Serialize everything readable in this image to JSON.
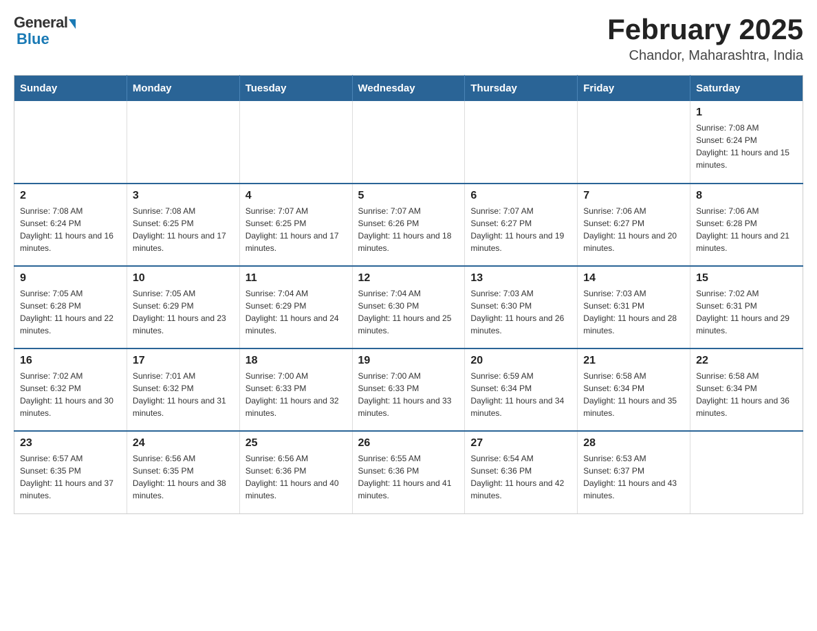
{
  "logo": {
    "general": "General",
    "blue": "Blue"
  },
  "title": "February 2025",
  "subtitle": "Chandor, Maharashtra, India",
  "weekdays": [
    "Sunday",
    "Monday",
    "Tuesday",
    "Wednesday",
    "Thursday",
    "Friday",
    "Saturday"
  ],
  "weeks": [
    [
      {
        "day": "",
        "info": ""
      },
      {
        "day": "",
        "info": ""
      },
      {
        "day": "",
        "info": ""
      },
      {
        "day": "",
        "info": ""
      },
      {
        "day": "",
        "info": ""
      },
      {
        "day": "",
        "info": ""
      },
      {
        "day": "1",
        "info": "Sunrise: 7:08 AM\nSunset: 6:24 PM\nDaylight: 11 hours and 15 minutes."
      }
    ],
    [
      {
        "day": "2",
        "info": "Sunrise: 7:08 AM\nSunset: 6:24 PM\nDaylight: 11 hours and 16 minutes."
      },
      {
        "day": "3",
        "info": "Sunrise: 7:08 AM\nSunset: 6:25 PM\nDaylight: 11 hours and 17 minutes."
      },
      {
        "day": "4",
        "info": "Sunrise: 7:07 AM\nSunset: 6:25 PM\nDaylight: 11 hours and 17 minutes."
      },
      {
        "day": "5",
        "info": "Sunrise: 7:07 AM\nSunset: 6:26 PM\nDaylight: 11 hours and 18 minutes."
      },
      {
        "day": "6",
        "info": "Sunrise: 7:07 AM\nSunset: 6:27 PM\nDaylight: 11 hours and 19 minutes."
      },
      {
        "day": "7",
        "info": "Sunrise: 7:06 AM\nSunset: 6:27 PM\nDaylight: 11 hours and 20 minutes."
      },
      {
        "day": "8",
        "info": "Sunrise: 7:06 AM\nSunset: 6:28 PM\nDaylight: 11 hours and 21 minutes."
      }
    ],
    [
      {
        "day": "9",
        "info": "Sunrise: 7:05 AM\nSunset: 6:28 PM\nDaylight: 11 hours and 22 minutes."
      },
      {
        "day": "10",
        "info": "Sunrise: 7:05 AM\nSunset: 6:29 PM\nDaylight: 11 hours and 23 minutes."
      },
      {
        "day": "11",
        "info": "Sunrise: 7:04 AM\nSunset: 6:29 PM\nDaylight: 11 hours and 24 minutes."
      },
      {
        "day": "12",
        "info": "Sunrise: 7:04 AM\nSunset: 6:30 PM\nDaylight: 11 hours and 25 minutes."
      },
      {
        "day": "13",
        "info": "Sunrise: 7:03 AM\nSunset: 6:30 PM\nDaylight: 11 hours and 26 minutes."
      },
      {
        "day": "14",
        "info": "Sunrise: 7:03 AM\nSunset: 6:31 PM\nDaylight: 11 hours and 28 minutes."
      },
      {
        "day": "15",
        "info": "Sunrise: 7:02 AM\nSunset: 6:31 PM\nDaylight: 11 hours and 29 minutes."
      }
    ],
    [
      {
        "day": "16",
        "info": "Sunrise: 7:02 AM\nSunset: 6:32 PM\nDaylight: 11 hours and 30 minutes."
      },
      {
        "day": "17",
        "info": "Sunrise: 7:01 AM\nSunset: 6:32 PM\nDaylight: 11 hours and 31 minutes."
      },
      {
        "day": "18",
        "info": "Sunrise: 7:00 AM\nSunset: 6:33 PM\nDaylight: 11 hours and 32 minutes."
      },
      {
        "day": "19",
        "info": "Sunrise: 7:00 AM\nSunset: 6:33 PM\nDaylight: 11 hours and 33 minutes."
      },
      {
        "day": "20",
        "info": "Sunrise: 6:59 AM\nSunset: 6:34 PM\nDaylight: 11 hours and 34 minutes."
      },
      {
        "day": "21",
        "info": "Sunrise: 6:58 AM\nSunset: 6:34 PM\nDaylight: 11 hours and 35 minutes."
      },
      {
        "day": "22",
        "info": "Sunrise: 6:58 AM\nSunset: 6:34 PM\nDaylight: 11 hours and 36 minutes."
      }
    ],
    [
      {
        "day": "23",
        "info": "Sunrise: 6:57 AM\nSunset: 6:35 PM\nDaylight: 11 hours and 37 minutes."
      },
      {
        "day": "24",
        "info": "Sunrise: 6:56 AM\nSunset: 6:35 PM\nDaylight: 11 hours and 38 minutes."
      },
      {
        "day": "25",
        "info": "Sunrise: 6:56 AM\nSunset: 6:36 PM\nDaylight: 11 hours and 40 minutes."
      },
      {
        "day": "26",
        "info": "Sunrise: 6:55 AM\nSunset: 6:36 PM\nDaylight: 11 hours and 41 minutes."
      },
      {
        "day": "27",
        "info": "Sunrise: 6:54 AM\nSunset: 6:36 PM\nDaylight: 11 hours and 42 minutes."
      },
      {
        "day": "28",
        "info": "Sunrise: 6:53 AM\nSunset: 6:37 PM\nDaylight: 11 hours and 43 minutes."
      },
      {
        "day": "",
        "info": ""
      }
    ]
  ]
}
